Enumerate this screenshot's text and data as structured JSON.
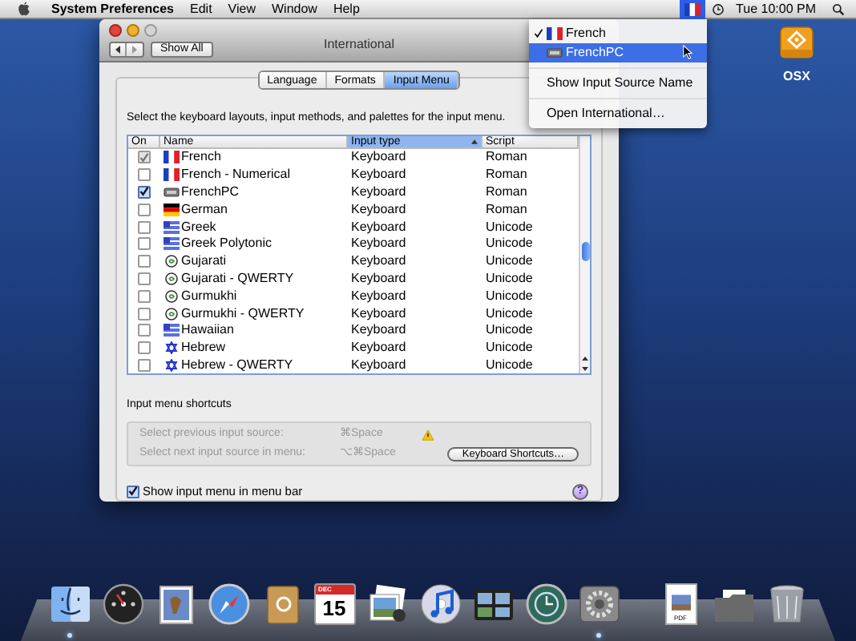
{
  "menu_bar": {
    "app": "System Preferences",
    "items": [
      "Edit",
      "View",
      "Window",
      "Help"
    ],
    "clock": "Tue 10:00 PM"
  },
  "input_menu": {
    "items": [
      {
        "kind": "flag_source",
        "label": "French",
        "checked": true,
        "selected": false
      },
      {
        "kind": "keyboard_source",
        "label": "FrenchPC",
        "checked": false,
        "selected": true
      },
      {
        "kind": "separator"
      },
      {
        "kind": "command",
        "label": "Show Input Source Name",
        "checked": false,
        "selected": false
      },
      {
        "kind": "separator"
      },
      {
        "kind": "command",
        "label": "Open International…",
        "checked": false,
        "selected": false
      }
    ]
  },
  "desktop_icons": [
    {
      "label": "OSX"
    }
  ],
  "window": {
    "title": "International",
    "show_all": "Show All",
    "tabs": [
      {
        "label": "Language",
        "selected": false
      },
      {
        "label": "Formats",
        "selected": false
      },
      {
        "label": "Input Menu",
        "selected": true
      }
    ],
    "instructions": "Select the keyboard layouts, input methods, and palettes for the input menu.",
    "table": {
      "columns": [
        {
          "label": "On",
          "sorted": false
        },
        {
          "label": "Name",
          "sorted": false
        },
        {
          "label": "Input type",
          "sorted": true
        },
        {
          "label": "Script",
          "sorted": false
        }
      ],
      "rows": [
        {
          "kind": "tricolor",
          "name": "French",
          "type": "Keyboard",
          "script": "Roman",
          "checked": true,
          "disabled": true
        },
        {
          "kind": "tricolor",
          "name": "French - Numerical",
          "type": "Keyboard",
          "script": "Roman",
          "checked": false,
          "disabled": false
        },
        {
          "kind": "keyboard",
          "name": "FrenchPC",
          "type": "Keyboard",
          "script": "Roman",
          "checked": true,
          "disabled": false
        },
        {
          "kind": "bands",
          "name": "German",
          "type": "Keyboard",
          "script": "Roman",
          "checked": false,
          "disabled": false
        },
        {
          "kind": "stripes",
          "name": "Greek",
          "type": "Keyboard",
          "script": "Unicode",
          "checked": false,
          "disabled": false
        },
        {
          "kind": "stripes",
          "name": "Greek Polytonic",
          "type": "Keyboard",
          "script": "Unicode",
          "checked": false,
          "disabled": false
        },
        {
          "kind": "glyph",
          "name": "Gujarati",
          "type": "Keyboard",
          "script": "Unicode",
          "checked": false,
          "disabled": false
        },
        {
          "kind": "glyph",
          "name": "Gujarati - QWERTY",
          "type": "Keyboard",
          "script": "Unicode",
          "checked": false,
          "disabled": false
        },
        {
          "kind": "glyph",
          "name": "Gurmukhi",
          "type": "Keyboard",
          "script": "Unicode",
          "checked": false,
          "disabled": false
        },
        {
          "kind": "glyph",
          "name": "Gurmukhi - QWERTY",
          "type": "Keyboard",
          "script": "Unicode",
          "checked": false,
          "disabled": false
        },
        {
          "kind": "stripes",
          "name": "Hawaiian",
          "type": "Keyboard",
          "script": "Unicode",
          "checked": false,
          "disabled": false
        },
        {
          "kind": "star",
          "name": "Hebrew",
          "type": "Keyboard",
          "script": "Unicode",
          "checked": false,
          "disabled": false
        },
        {
          "kind": "star",
          "name": "Hebrew - QWERTY",
          "type": "Keyboard",
          "script": "Unicode",
          "checked": false,
          "disabled": false
        }
      ]
    },
    "shortcuts": {
      "title": "Input menu shortcuts",
      "rows": [
        {
          "label": "Select previous input source:",
          "keys": "⌘Space",
          "warning": true
        },
        {
          "label": "Select next input source in menu:",
          "keys": "⌥⌘Space",
          "warning": false
        }
      ],
      "button": "Keyboard Shortcuts…"
    },
    "show_menu": {
      "label": "Show input menu in menu bar",
      "checked": true
    },
    "help": "?"
  },
  "dock": {
    "items": [
      {
        "kind": "finder",
        "running": true
      },
      {
        "kind": "dashboard",
        "running": false
      },
      {
        "kind": "mail",
        "running": false
      },
      {
        "kind": "safari",
        "running": false
      },
      {
        "kind": "addressbook",
        "running": false
      },
      {
        "kind": "calendar",
        "running": false,
        "month": "DEC",
        "day": "15"
      },
      {
        "kind": "photos",
        "running": false
      },
      {
        "kind": "music",
        "running": false
      },
      {
        "kind": "spaces",
        "running": false
      },
      {
        "kind": "timemachine",
        "running": false
      },
      {
        "kind": "settings",
        "running": true
      },
      {
        "kind": "divider"
      },
      {
        "kind": "document",
        "running": false,
        "label": "PDF"
      },
      {
        "kind": "folder",
        "running": false
      },
      {
        "kind": "trash",
        "running": false
      }
    ]
  }
}
